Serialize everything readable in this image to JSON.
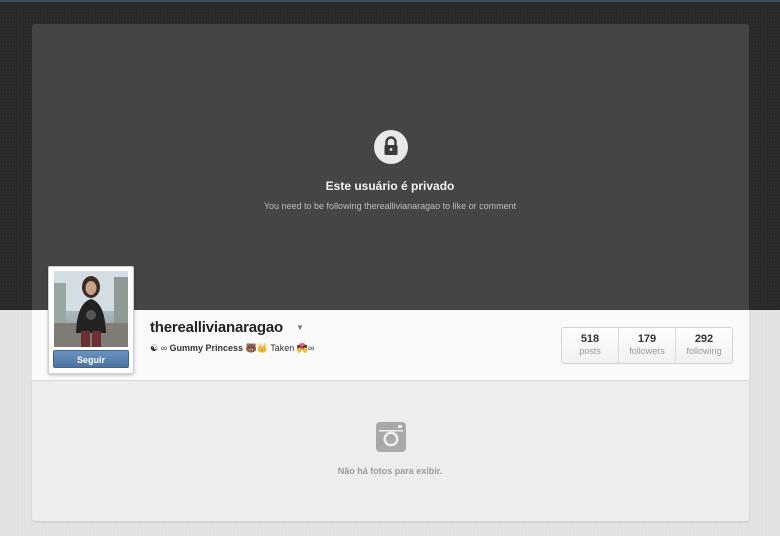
{
  "private_notice": {
    "title": "Este usuário é privado",
    "subtitle": "You need to be following thereallivianaragao to like or comment",
    "icon": "lock-icon"
  },
  "profile": {
    "username": "thereallivianaragao",
    "follow_label": "Seguir",
    "bio_prefix": "☯ ∞ ",
    "bio_bold": "Gummy Princess",
    "bio_suffix": " 🐻👑 Taken 💏∞",
    "avatar_icon": "profile-photo"
  },
  "stats": [
    {
      "count": "518",
      "label": "posts"
    },
    {
      "count": "179",
      "label": "followers"
    },
    {
      "count": "292",
      "label": "following"
    }
  ],
  "photos": {
    "empty_message": "Não há fotos para exibir.",
    "icon": "camera-icon"
  },
  "colors": {
    "follow_button": "#4a73a2",
    "dark_panel": "#454545"
  }
}
